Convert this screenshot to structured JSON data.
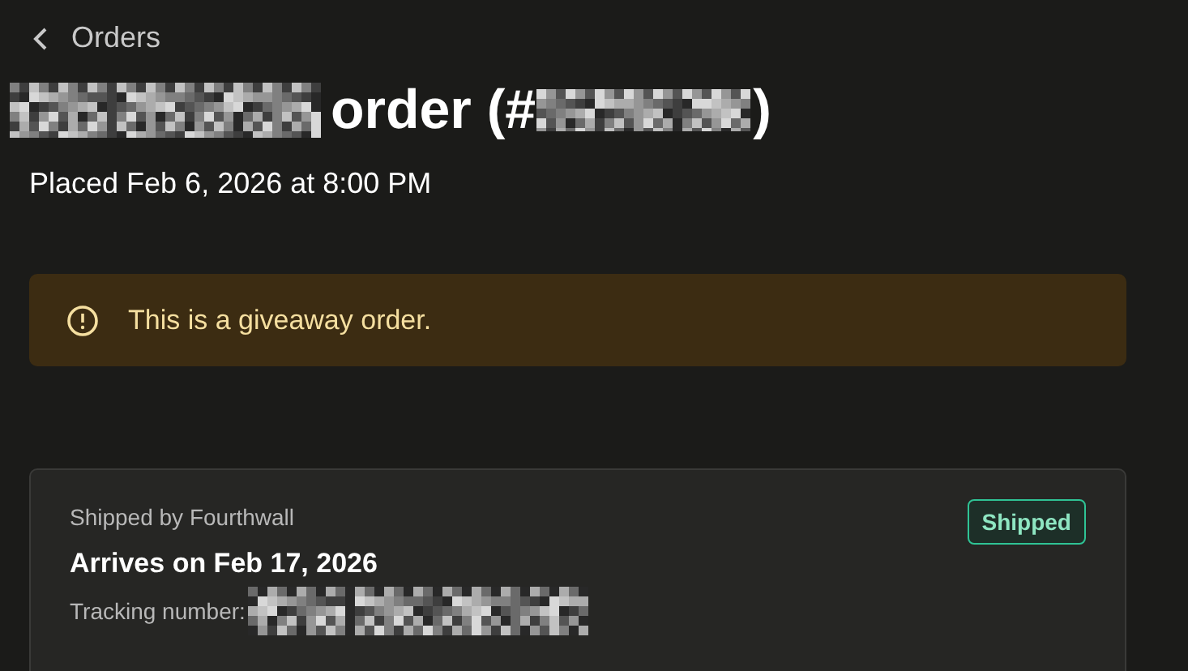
{
  "back_link": {
    "label": "Orders"
  },
  "title": {
    "text_before": "order (#",
    "text_after": ")"
  },
  "placed": "Placed Feb 6, 2026 at 8:00 PM",
  "notice": {
    "kind": "warning",
    "text": "This is a giveaway order."
  },
  "shipment": {
    "shipped_by": "Shipped by Fourthwall",
    "arrival": "Arrives on Feb 17, 2026",
    "tracking_label": "Tracking number:",
    "status": {
      "label": "Shipped",
      "kind": "success"
    }
  }
}
